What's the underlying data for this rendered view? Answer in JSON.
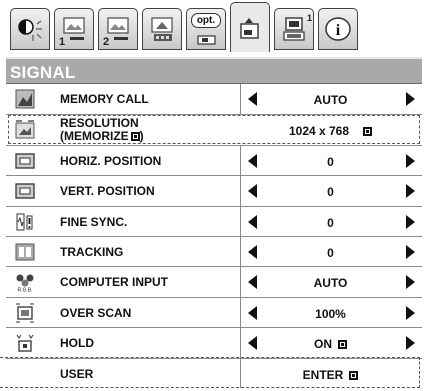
{
  "tabs": [
    {
      "icon": "picture-adjust-icon",
      "index": ""
    },
    {
      "icon": "image-memory-1-icon",
      "index": "1"
    },
    {
      "icon": "image-memory-2-icon",
      "index": "2"
    },
    {
      "icon": "installation-icon",
      "index": ""
    },
    {
      "icon": "option-icon",
      "index": "",
      "badge": "opt."
    },
    {
      "icon": "signal-icon",
      "index": "",
      "active": true
    },
    {
      "icon": "source-select-icon",
      "index": "1"
    },
    {
      "icon": "info-icon",
      "index": ""
    }
  ],
  "panel": {
    "title": "SIGNAL",
    "rows": [
      {
        "icon": "memory-call-icon",
        "label": "MEMORY CALL",
        "value": "AUTO",
        "arrows": true
      },
      {
        "icon": "resolution-icon",
        "label_line1": "RESOLUTION",
        "label_line2": "(MEMORIZE",
        "label_line2_end": ")",
        "value": "1024 x 768",
        "value_mark": true,
        "arrows": false
      },
      {
        "icon": "horiz-position-icon",
        "label": "HORIZ. POSITION",
        "value": "0",
        "arrows": true
      },
      {
        "icon": "vert-position-icon",
        "label": "VERT. POSITION",
        "value": "0",
        "arrows": true
      },
      {
        "icon": "fine-sync-icon",
        "label": "FINE SYNC.",
        "value": "0",
        "arrows": true
      },
      {
        "icon": "tracking-icon",
        "label": "TRACKING",
        "value": "0",
        "arrows": true
      },
      {
        "icon": "computer-input-icon",
        "label": "COMPUTER INPUT",
        "value": "AUTO",
        "arrows": true
      },
      {
        "icon": "over-scan-icon",
        "label": "OVER SCAN",
        "value": "100%",
        "arrows": true
      },
      {
        "icon": "hold-icon",
        "label": "HOLD",
        "value": "ON",
        "value_mark": true,
        "arrows": true
      },
      {
        "icon": "",
        "label": "USER",
        "value": "ENTER",
        "value_mark": true,
        "arrows": false
      }
    ]
  },
  "colors": {
    "title_bar": "#a9a9a9",
    "title_text": "#ffffff",
    "text": "#111111"
  }
}
